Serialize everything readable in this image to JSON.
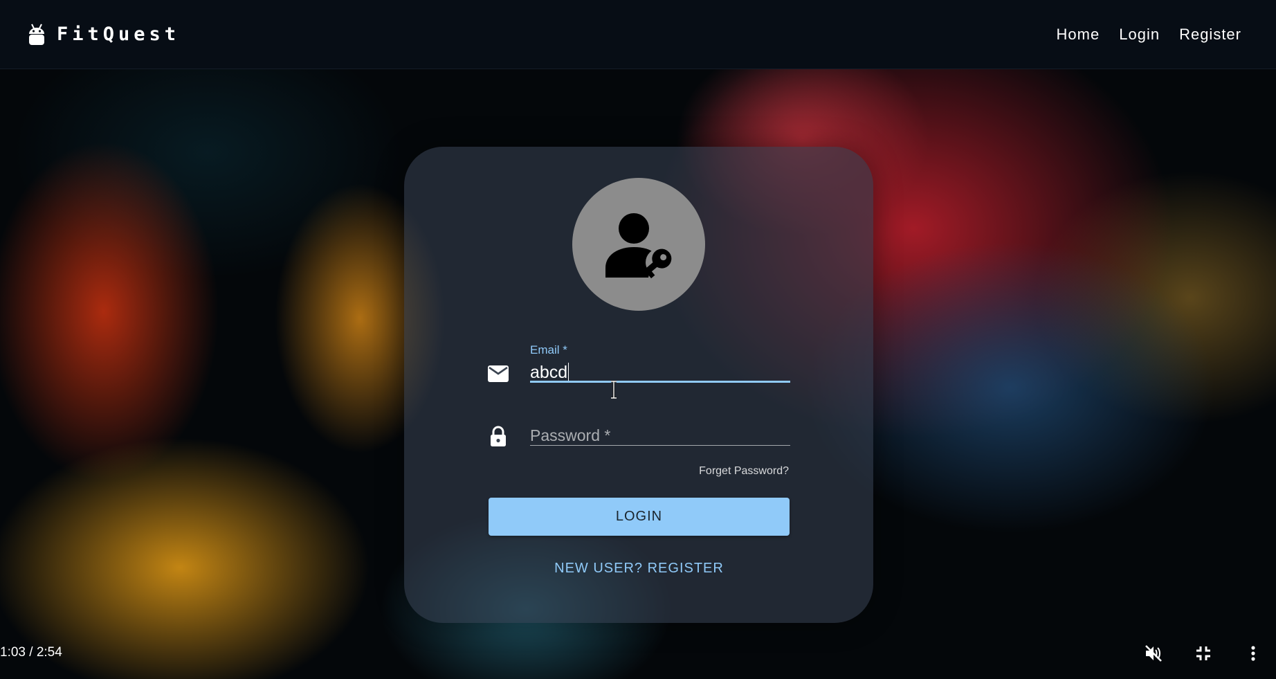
{
  "app": {
    "brand_name": "FitQuest",
    "brand_icon": "android-icon"
  },
  "nav": {
    "home": "Home",
    "login": "Login",
    "register": "Register"
  },
  "login_card": {
    "avatar_icon": "person-key-icon",
    "email": {
      "label": "Email *",
      "value": "abcd",
      "icon": "mail-icon"
    },
    "password": {
      "placeholder": "Password *",
      "value": "",
      "icon": "lock-icon"
    },
    "forgot_password": "Forget Password?",
    "login_button": "LOGIN",
    "register_link": "NEW USER? REGISTER"
  },
  "video": {
    "time": "1:03 / 2:54",
    "controls": [
      "mute-icon",
      "exit-fullscreen-icon",
      "more-vert-icon"
    ]
  },
  "colors": {
    "accent": "#90caf9",
    "navbar": "#070d15",
    "avatar_bg": "#8c8c8c"
  }
}
